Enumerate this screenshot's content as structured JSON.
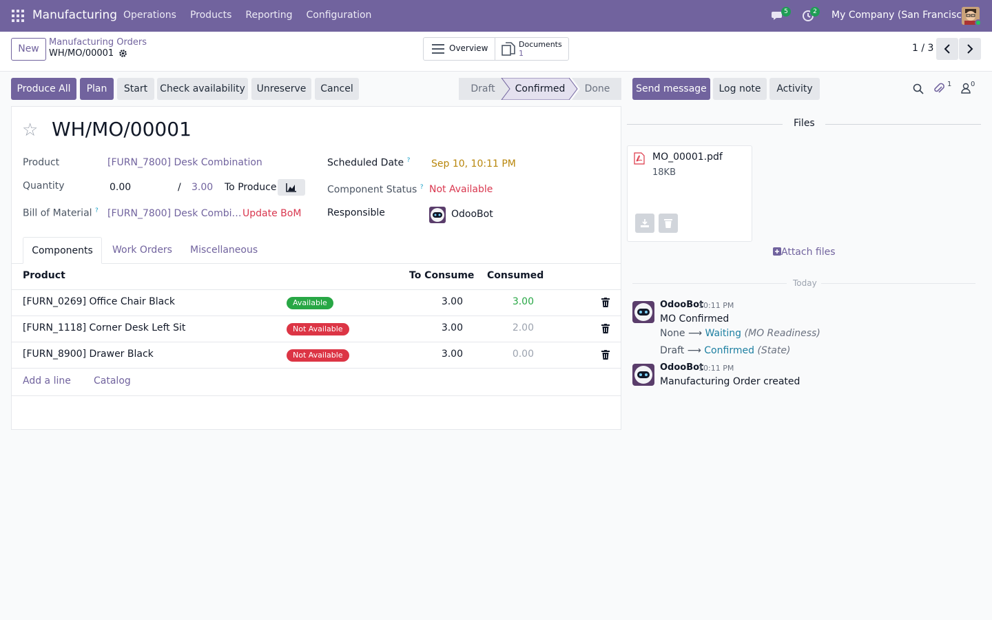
{
  "navbar": {
    "app_name": "Manufacturing",
    "menu": [
      "Operations",
      "Products",
      "Reporting",
      "Configuration"
    ],
    "messages_count": "5",
    "activities_count": "2",
    "company": "My Company (San Francisco)"
  },
  "control_panel": {
    "new_label": "New",
    "breadcrumb_parent": "Manufacturing Orders",
    "breadcrumb_current": "WH/MO/00001",
    "overview_label": "Overview",
    "documents_label": "Documents",
    "documents_count": "1",
    "pager": "1 / 3"
  },
  "actions": {
    "produce_all": "Produce All",
    "plan": "Plan",
    "start": "Start",
    "check_availability": "Check availability",
    "unreserve": "Unreserve",
    "cancel": "Cancel"
  },
  "stages": {
    "draft": "Draft",
    "confirmed": "Confirmed",
    "done": "Done"
  },
  "form": {
    "title": "WH/MO/00001",
    "product_label": "Product",
    "product_value": "[FURN_7800] Desk Combination",
    "quantity_label": "Quantity",
    "quantity_produced": "0.00",
    "quantity_slash": "/",
    "quantity_total": "3.00",
    "to_produce_label": "To Produce",
    "bom_label": "Bill of Material",
    "bom_value": "[FURN_7800] Desk Combi…",
    "update_bom": "Update BoM",
    "scheduled_label": "Scheduled Date",
    "scheduled_value": "Sep 10, 10:11 PM",
    "component_status_label": "Component Status",
    "component_status_value": "Not Available",
    "responsible_label": "Responsible",
    "responsible_value": "OdooBot",
    "help_mark": "?"
  },
  "tabs": [
    "Components",
    "Work Orders",
    "Miscellaneous"
  ],
  "table": {
    "headers": {
      "product": "Product",
      "to_consume": "To Consume",
      "consumed": "Consumed"
    },
    "rows": [
      {
        "product": "[FURN_0269] Office Chair Black",
        "status": "Available",
        "to_consume": "3.00",
        "consumed": "3.00"
      },
      {
        "product": "[FURN_1118] Corner Desk Left Sit",
        "status": "Not Available",
        "to_consume": "3.00",
        "consumed": "2.00"
      },
      {
        "product": "[FURN_8900] Drawer Black",
        "status": "Not Available",
        "to_consume": "3.00",
        "consumed": "0.00"
      }
    ],
    "add_line": "Add a line",
    "catalog": "Catalog"
  },
  "chatter": {
    "send_message": "Send message",
    "log_note": "Log note",
    "activity": "Activity",
    "attachments_count": "1",
    "followers_count": "0",
    "files_title": "Files",
    "file_name": "MO_00001.pdf",
    "file_size": "18KB",
    "attach_files": "Attach files",
    "today": "Today",
    "messages": [
      {
        "author": "OdooBot",
        "time": "10:11 PM",
        "body": "MO Confirmed",
        "tracking": [
          {
            "old": "None",
            "new": "Waiting",
            "field": "(MO Readiness)"
          },
          {
            "old": "Draft",
            "new": "Confirmed",
            "field": "(State)"
          }
        ]
      },
      {
        "author": "OdooBot",
        "time": "10:11 PM",
        "body": "Manufacturing Order created"
      }
    ]
  },
  "colors": {
    "brand": "#71639e",
    "success": "#28a745",
    "danger": "#dc3545",
    "warning_text": "#b8860b"
  }
}
